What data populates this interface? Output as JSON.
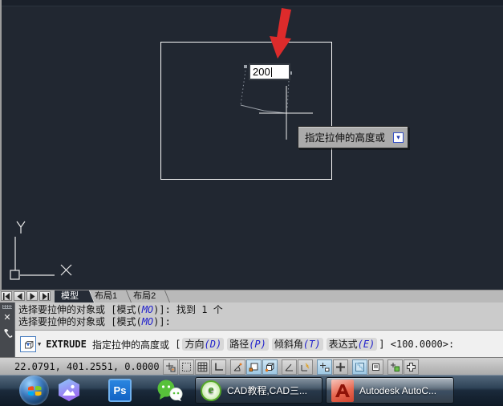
{
  "colors": {
    "canvas_bg": "#212731",
    "command_key_blue": "#2222cc",
    "arrow_red": "#dd2b2b",
    "osnap_active_bg": "#b5d7eb",
    "taskbar_glass": "#2e4357"
  },
  "canvas": {
    "dynamic_input": {
      "value": "200"
    },
    "tooltip": {
      "text": "指定拉伸的高度或",
      "more_glyph": "▾"
    }
  },
  "tabs": {
    "items": [
      {
        "label": "模型",
        "active": true
      },
      {
        "label": "布局1",
        "active": false
      },
      {
        "label": "布局2",
        "active": false
      }
    ]
  },
  "command": {
    "close_glyph": "✕",
    "dropdown_glyph": "▼",
    "history": [
      {
        "pre": "选择要拉伸的对象或 [模式(",
        "key": "MO",
        "post": ")]: 找到 1 个"
      },
      {
        "pre": "选择要拉伸的对象或 [模式(",
        "key": "MO",
        "post": ")]:"
      }
    ],
    "prompt": {
      "command": "EXTRUDE",
      "text": " 指定拉伸的高度或 ",
      "bracket_open": "[",
      "options": [
        {
          "label": "方向",
          "key": "(D)"
        },
        {
          "label": "路径",
          "key": "(P)"
        },
        {
          "label": "倾斜角",
          "key": "(T)"
        },
        {
          "label": "表达式",
          "key": "(E)"
        }
      ],
      "bracket_close": "]",
      "default_value": " <100.0000>:"
    }
  },
  "status": {
    "coords": "22.0791,  401.2551, 0.0000",
    "toggles": [
      {
        "name": "snap-mode",
        "active": false
      },
      {
        "name": "grid-snap",
        "active": false
      },
      {
        "name": "grid-display",
        "active": false
      },
      {
        "name": "ortho-mode",
        "active": false
      },
      {
        "name": "polar-tracking",
        "active": false
      },
      {
        "name": "object-snap",
        "active": true
      },
      {
        "name": "3d-object-snap",
        "active": true
      },
      {
        "name": "object-snap-tracking",
        "active": false
      },
      {
        "name": "dynamic-ucs",
        "active": false
      },
      {
        "name": "dynamic-input",
        "active": true
      },
      {
        "name": "lineweight",
        "active": false
      },
      {
        "name": "transparency",
        "active": true
      },
      {
        "name": "quick-properties",
        "active": false
      },
      {
        "name": "selection-cycling",
        "active": false
      },
      {
        "name": "annotation-monitor",
        "active": false
      }
    ]
  },
  "taskbar": {
    "ps_label": "Ps",
    "browser_logo_glyph": "e",
    "windows": [
      {
        "label": "CAD教程,CAD三...",
        "active": false
      },
      {
        "label": "Autodesk AutoC...",
        "active": true
      }
    ]
  }
}
